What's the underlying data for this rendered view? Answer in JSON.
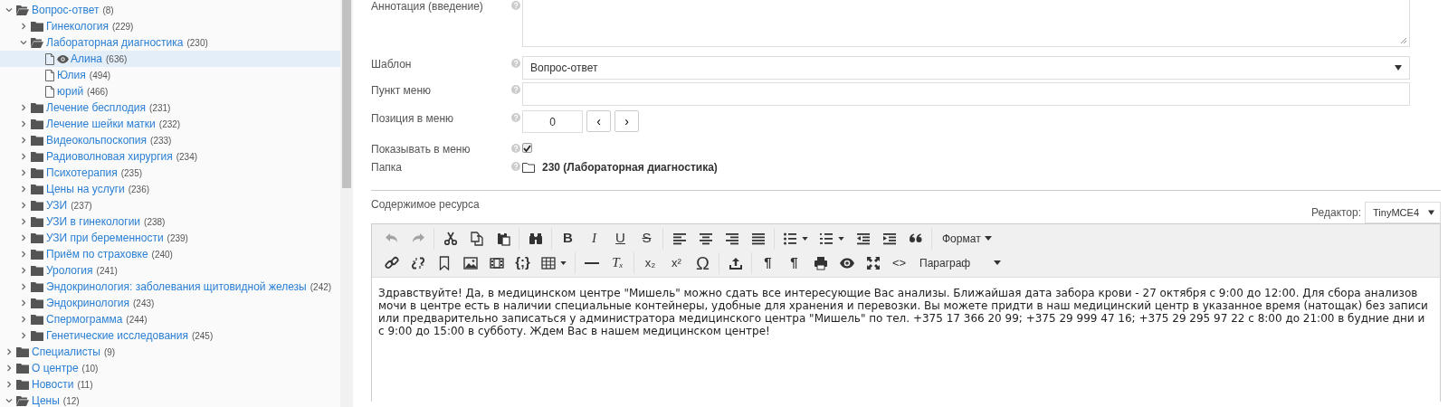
{
  "tree": [
    {
      "label": "Вопрос-ответ",
      "count": "(8)",
      "kind": "folder",
      "expanded": true,
      "selected": false,
      "children": [
        {
          "label": "Гинекология",
          "count": "(229)",
          "kind": "folder",
          "expanded": false,
          "selected": false
        },
        {
          "label": "Лабораторная диагностика",
          "count": "(230)",
          "kind": "folder",
          "expanded": true,
          "selected": false,
          "children": [
            {
              "label": "Алина",
              "count": "(636)",
              "kind": "file",
              "selected": true
            },
            {
              "label": "Юлия",
              "count": "(494)",
              "kind": "file",
              "selected": false
            },
            {
              "label": "юрий",
              "count": "(466)",
              "kind": "file",
              "selected": false
            }
          ]
        },
        {
          "label": "Лечение бесплодия",
          "count": "(231)",
          "kind": "folder",
          "expanded": false,
          "selected": false
        },
        {
          "label": "Лечение шейки матки",
          "count": "(232)",
          "kind": "folder",
          "expanded": false,
          "selected": false
        },
        {
          "label": "Видеокольпоскопия",
          "count": "(233)",
          "kind": "folder",
          "expanded": false,
          "selected": false
        },
        {
          "label": "Радиоволновая хирургия",
          "count": "(234)",
          "kind": "folder",
          "expanded": false,
          "selected": false
        },
        {
          "label": "Психотерапия",
          "count": "(235)",
          "kind": "folder",
          "expanded": false,
          "selected": false
        },
        {
          "label": "Цены на услуги",
          "count": "(236)",
          "kind": "folder",
          "expanded": false,
          "selected": false
        },
        {
          "label": "УЗИ",
          "count": "(237)",
          "kind": "folder",
          "expanded": false,
          "selected": false
        },
        {
          "label": "УЗИ в гинекологии",
          "count": "(238)",
          "kind": "folder",
          "expanded": false,
          "selected": false
        },
        {
          "label": "УЗИ при беременности",
          "count": "(239)",
          "kind": "folder",
          "expanded": false,
          "selected": false
        },
        {
          "label": "Приём по страховке",
          "count": "(240)",
          "kind": "folder",
          "expanded": false,
          "selected": false
        },
        {
          "label": "Урология",
          "count": "(241)",
          "kind": "folder",
          "expanded": false,
          "selected": false
        },
        {
          "label": "Эндокринология: заболевания щитовидной железы",
          "count": "(242)",
          "kind": "folder",
          "expanded": false,
          "selected": false
        },
        {
          "label": "Эндокринология",
          "count": "(243)",
          "kind": "folder",
          "expanded": false,
          "selected": false
        },
        {
          "label": "Спермограмма",
          "count": "(244)",
          "kind": "folder",
          "expanded": false,
          "selected": false
        },
        {
          "label": "Генетические исследования",
          "count": "(245)",
          "kind": "folder",
          "expanded": false,
          "selected": false
        }
      ]
    },
    {
      "label": "Специалисты",
      "count": "(9)",
      "kind": "folder",
      "expanded": false,
      "selected": false
    },
    {
      "label": "О центре",
      "count": "(10)",
      "kind": "folder",
      "expanded": false,
      "selected": false
    },
    {
      "label": "Новости",
      "count": "(11)",
      "kind": "folder",
      "expanded": false,
      "selected": false
    },
    {
      "label": "Цены",
      "count": "(12)",
      "kind": "folder",
      "expanded": true,
      "selected": false
    }
  ],
  "form": [
    {
      "label": "Аннотация (введение)",
      "kind": "textarea"
    },
    {
      "label": "Шаблон",
      "kind": "select",
      "value": "Вопрос-ответ"
    },
    {
      "label": "Пункт меню",
      "kind": "input"
    },
    {
      "label": "Позиция в меню",
      "kind": "stepper",
      "value": "0",
      "prev": "‹",
      "next": "›"
    },
    {
      "label": "Показывать в меню",
      "kind": "checkbox",
      "checked": true
    },
    {
      "label": "Папка",
      "kind": "folder",
      "value": "230 (Лабораторная диагностика)"
    }
  ],
  "content": {
    "label": "Содержимое ресурса",
    "editor_label": "Редактор:",
    "editor_value": "TinyMCE4",
    "toolbar": [
      [
        [
          {
            "kind": "icon",
            "disabled": true
          },
          {
            "kind": "icon",
            "disabled": true
          }
        ],
        [
          {
            "kind": "icon",
            "disabled": false
          },
          {
            "kind": "icon",
            "disabled": false
          },
          {
            "kind": "icon",
            "disabled": false
          }
        ],
        [
          {
            "kind": "icon",
            "disabled": false
          }
        ],
        [
          {
            "kind": "glyph",
            "text": "B",
            "disabled": false
          },
          {
            "kind": "glyph",
            "text": "I",
            "disabled": false
          },
          {
            "kind": "glyph",
            "text": "U",
            "disabled": false
          },
          {
            "kind": "glyph",
            "text": "S",
            "disabled": false
          }
        ],
        [
          {
            "kind": "icon",
            "disabled": false
          },
          {
            "kind": "icon",
            "disabled": false
          },
          {
            "kind": "icon",
            "disabled": false
          },
          {
            "kind": "icon",
            "disabled": false
          }
        ],
        [
          {
            "kind": "split",
            "disabled": false
          },
          {
            "kind": "split",
            "disabled": false
          },
          {
            "kind": "icon",
            "disabled": false
          },
          {
            "kind": "icon",
            "disabled": false
          },
          {
            "kind": "icon",
            "disabled": false
          }
        ],
        [
          {
            "kind": "menu",
            "text": "Формат"
          }
        ]
      ],
      [
        [
          {
            "kind": "icon",
            "disabled": false
          },
          {
            "kind": "icon",
            "disabled": false
          },
          {
            "kind": "icon",
            "disabled": false
          },
          {
            "kind": "icon",
            "disabled": false
          },
          {
            "kind": "icon",
            "disabled": false
          },
          {
            "kind": "glyph",
            "text": "{;}",
            "disabled": false
          },
          {
            "kind": "split",
            "disabled": false
          }
        ],
        [
          {
            "kind": "icon",
            "disabled": false
          },
          {
            "kind": "glyph",
            "text": "Tₓ",
            "disabled": false
          }
        ],
        [
          {
            "kind": "glyph",
            "text": "x₂",
            "disabled": false
          },
          {
            "kind": "glyph",
            "text": "x²",
            "disabled": false
          },
          {
            "kind": "glyph",
            "text": "Ω",
            "disabled": false
          }
        ],
        [
          {
            "kind": "icon",
            "disabled": false
          }
        ],
        [
          {
            "kind": "glyph",
            "text": "¶",
            "disabled": false
          },
          {
            "kind": "glyph",
            "text": "¶",
            "disabled": false
          },
          {
            "kind": "icon",
            "disabled": false
          },
          {
            "kind": "icon",
            "disabled": false
          },
          {
            "kind": "icon",
            "disabled": false
          },
          {
            "kind": "glyph",
            "text": "<>",
            "disabled": false
          },
          {
            "kind": "menu",
            "text": "Параграф"
          }
        ]
      ]
    ],
    "text": "Здравствуйте! Да, в медицинском центре \"Мишель\" можно сдать все интересующие Вас анализы. Ближайшая дата забора крови - 27 октября с 9:00 до 12:00. Для сбора анализов мочи в центре есть в наличии специальные контейнеры, удобные для хранения и перевозки. Вы можете придти в наш медицинский центр в указанное время (натощак) без записи или предварительно записаться у администратора медицинского центра \"Мишель\" по тел. +375 17 366 20 99; +375 29 999 47 16; +375 29 295 97 22 с 8:00 до 21:00 в будние дни и с 9:00 до 15:00 в субботу. Ждем Вас в нашем медицинском центре!"
  }
}
